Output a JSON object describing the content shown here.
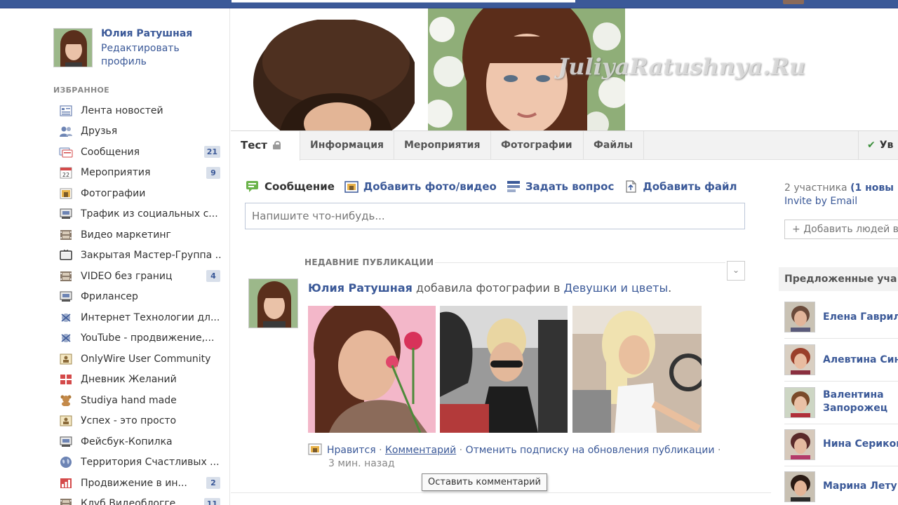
{
  "cover": {
    "watermark": "JuliyaRatushnya.Ru"
  },
  "profile": {
    "name": "Юлия Ратушная",
    "edit_line1": "Редактировать",
    "edit_line2": "профиль"
  },
  "sidebar": {
    "section_title": "ИЗБРАННОЕ",
    "items": [
      {
        "label": "Лента новостей",
        "icon": "news-feed-icon",
        "count": ""
      },
      {
        "label": "Друзья",
        "icon": "friends-icon",
        "count": ""
      },
      {
        "label": "Сообщения",
        "icon": "messages-icon",
        "count": "21"
      },
      {
        "label": "Мероприятия",
        "icon": "calendar-icon",
        "count": "9"
      },
      {
        "label": "Фотографии",
        "icon": "photos-icon",
        "count": ""
      },
      {
        "label": "Трафик из социальных с...",
        "icon": "group-icon",
        "count": ""
      },
      {
        "label": "Видео маркетинг",
        "icon": "film-icon",
        "count": ""
      },
      {
        "label": "Закрытая Мастер-Группа ...",
        "icon": "tv-icon",
        "count": ""
      },
      {
        "label": "VIDEO без границ",
        "icon": "film-icon",
        "count": "4"
      },
      {
        "label": "Фрилансер",
        "icon": "group-icon",
        "count": ""
      },
      {
        "label": "Интернет Технологии дл...",
        "icon": "app-icon",
        "count": ""
      },
      {
        "label": "YouTube - продвижение,...",
        "icon": "app-icon",
        "count": ""
      },
      {
        "label": "OnlyWire User Community",
        "icon": "page-icon",
        "count": ""
      },
      {
        "label": "Дневник Желаний",
        "icon": "gift-icon",
        "count": ""
      },
      {
        "label": "Studiya hand made",
        "icon": "bear-icon",
        "count": ""
      },
      {
        "label": "Успех - это просто",
        "icon": "page-icon",
        "count": ""
      },
      {
        "label": "Фейсбук-Копилка",
        "icon": "group-icon",
        "count": ""
      },
      {
        "label": "Территория Счастливых ...",
        "icon": "globe-icon",
        "count": ""
      },
      {
        "label": "Продвижение в ин...",
        "icon": "chart-icon",
        "count": "2"
      },
      {
        "label": "Клуб Видеоблогге...",
        "icon": "film-icon",
        "count": "11"
      }
    ]
  },
  "tabs": [
    {
      "label": "Тест"
    },
    {
      "label": "Информация"
    },
    {
      "label": "Мероприятия"
    },
    {
      "label": "Фотографии"
    },
    {
      "label": "Файлы"
    }
  ],
  "notifications_button": "Ув",
  "composer": {
    "actions": [
      {
        "label": "Сообщение",
        "icon": "status-icon"
      },
      {
        "label": "Добавить фото/видео",
        "icon": "photo-icon"
      },
      {
        "label": "Задать вопрос",
        "icon": "question-icon"
      },
      {
        "label": "Добавить файл",
        "icon": "file-icon"
      }
    ],
    "placeholder": "Напишите что-нибудь..."
  },
  "recent": {
    "title": "НЕДАВНИЕ ПУБЛИКАЦИИ"
  },
  "post": {
    "author": "Юлия Ратушная",
    "action": "добавила фотографии в",
    "album": "Девушки и цветы",
    "like": "Нравится",
    "comment": "Комментарий",
    "unfollow": "Отменить подписку на обновления публикации",
    "time": "3 мин. назад",
    "tooltip": "Оставить комментарий"
  },
  "right": {
    "members": "2 участника",
    "members_new": "(1 новы",
    "invite": "Invite by Email",
    "add_people": "Добавить людей в",
    "suggested_title": "Предложенные уча",
    "people": [
      {
        "line1": "Елена Гаврил",
        "line2": ""
      },
      {
        "line1": "Алевтина Син",
        "line2": ""
      },
      {
        "line1": "Валентина",
        "line2": "Запорожец"
      },
      {
        "line1": "Нина Сериков",
        "line2": ""
      },
      {
        "line1": "Марина Лету",
        "line2": ""
      }
    ]
  },
  "colors": {
    "brand": "#3b5998",
    "count_badge": "#d8dfea",
    "check": "#3a8e3a"
  }
}
